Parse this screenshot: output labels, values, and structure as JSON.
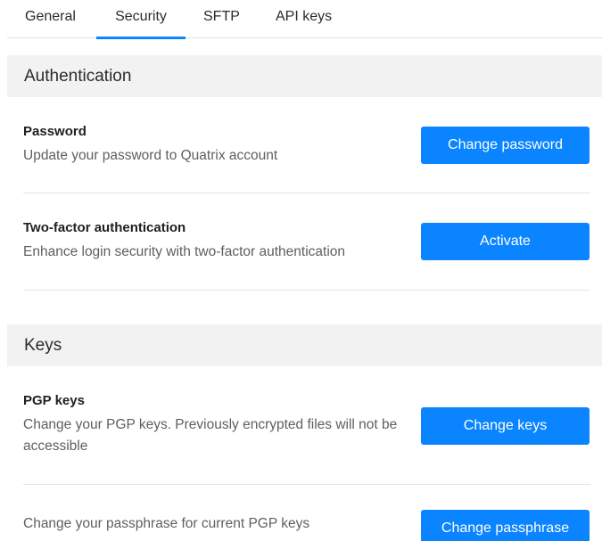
{
  "tabs": [
    {
      "label": "General",
      "active": false
    },
    {
      "label": "Security",
      "active": true
    },
    {
      "label": "SFTP",
      "active": false
    },
    {
      "label": "API keys",
      "active": false
    }
  ],
  "sections": {
    "authentication": {
      "title": "Authentication",
      "password": {
        "title": "Password",
        "description": "Update your password to Quatrix account",
        "button": "Change password"
      },
      "two_factor": {
        "title": "Two-factor authentication",
        "description": "Enhance login security with two-factor authentication",
        "button": "Activate"
      }
    },
    "keys": {
      "title": "Keys",
      "pgp": {
        "title": "PGP keys",
        "description": "Change your PGP keys. Previously encrypted files will not be accessible",
        "button": "Change keys"
      },
      "passphrase": {
        "description": "Change your passphrase for current PGP keys",
        "button": "Change passphrase"
      }
    }
  },
  "colors": {
    "accent": "#0a84ff",
    "section_bg": "#f2f2f2",
    "muted_text": "#5f5f5f",
    "divider": "#e4e4e4"
  }
}
